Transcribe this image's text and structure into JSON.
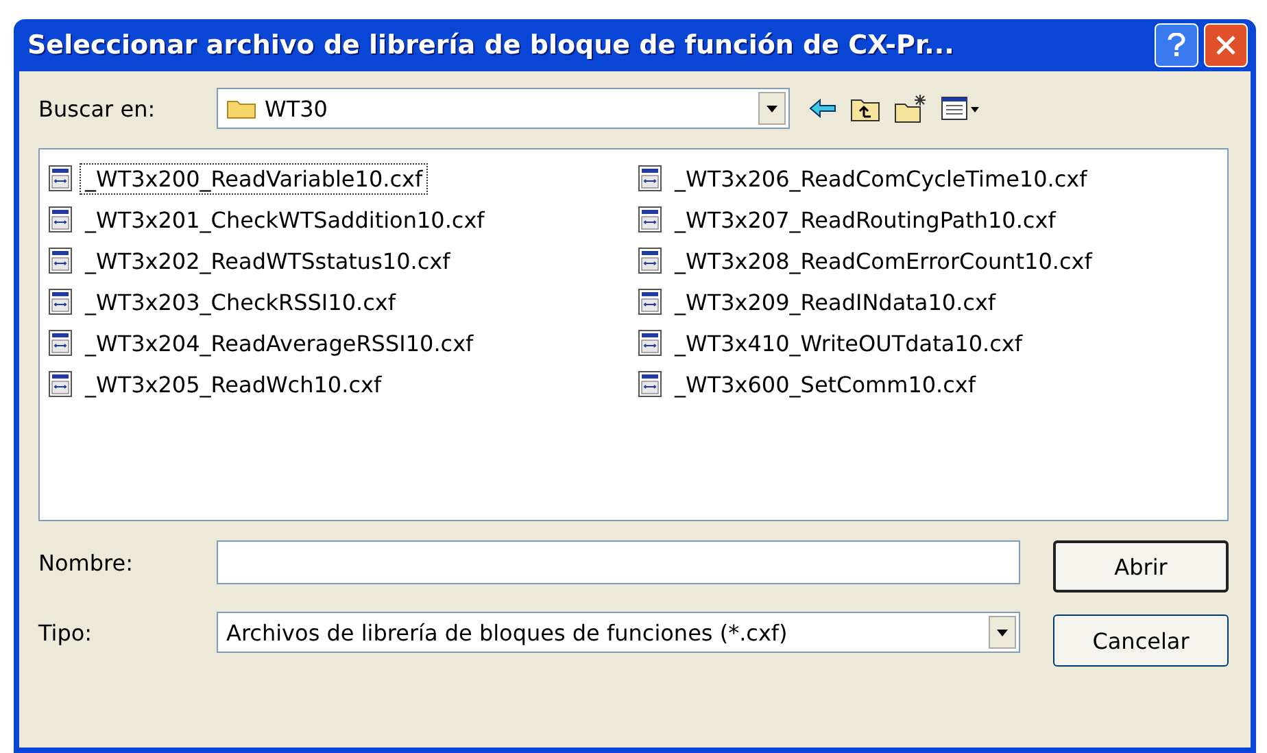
{
  "window": {
    "title": "Seleccionar archivo de librería de bloque de función de CX-Pr..."
  },
  "look_in": {
    "label": "Buscar en:",
    "value": "WT30"
  },
  "files": [
    {
      "name": "_WT3x200_ReadVariable10.cxf",
      "focused": true
    },
    {
      "name": "_WT3x201_CheckWTSaddition10.cxf",
      "focused": false
    },
    {
      "name": "_WT3x202_ReadWTSstatus10.cxf",
      "focused": false
    },
    {
      "name": "_WT3x203_CheckRSSI10.cxf",
      "focused": false
    },
    {
      "name": "_WT3x204_ReadAverageRSSI10.cxf",
      "focused": false
    },
    {
      "name": "_WT3x205_ReadWch10.cxf",
      "focused": false
    },
    {
      "name": "_WT3x206_ReadComCycleTime10.cxf",
      "focused": false
    },
    {
      "name": "_WT3x207_ReadRoutingPath10.cxf",
      "focused": false
    },
    {
      "name": "_WT3x208_ReadComErrorCount10.cxf",
      "focused": false
    },
    {
      "name": "_WT3x209_ReadINdata10.cxf",
      "focused": false
    },
    {
      "name": "_WT3x410_WriteOUTdata10.cxf",
      "focused": false
    },
    {
      "name": "_WT3x600_SetComm10.cxf",
      "focused": false
    }
  ],
  "file_name": {
    "label": "Nombre:"
  },
  "file_type": {
    "label": "Tipo:",
    "value": "Archivos de librería de bloques de funciones (*.cxf)"
  },
  "buttons": [
    {
      "label": "Abrir",
      "default": true
    },
    {
      "label": "Cancelar",
      "default": false
    }
  ]
}
